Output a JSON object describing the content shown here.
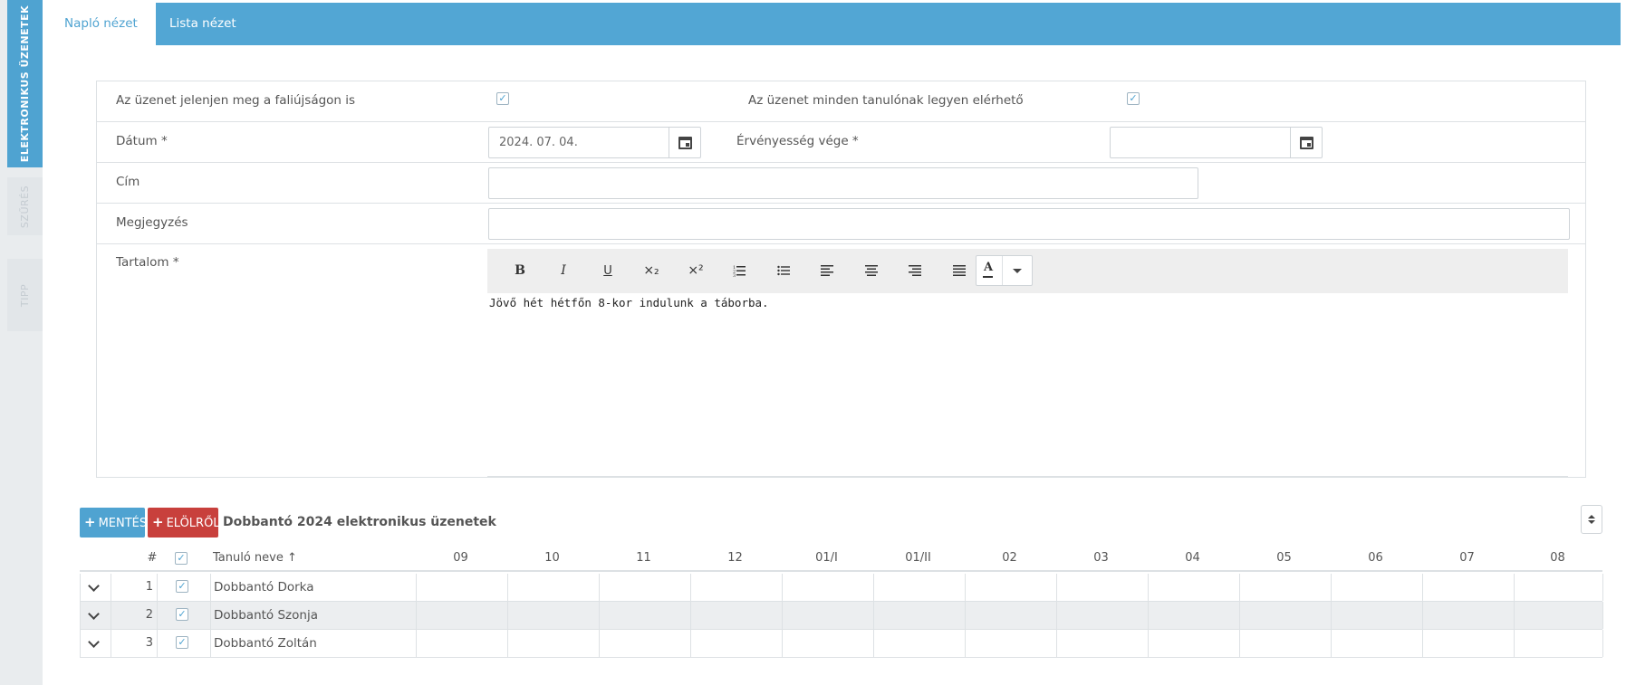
{
  "sidebar": {
    "tabs": [
      {
        "label": "ELEKTRONIKUS ÜZENETEK"
      },
      {
        "label": "SZŰRÉS"
      },
      {
        "label": "TIPP"
      }
    ]
  },
  "top_tabs": [
    {
      "label": "Napló nézet"
    },
    {
      "label": "Lista nézet"
    }
  ],
  "form": {
    "wall_label": "Az üzenet jelenjen meg a faliújságon is",
    "wall_checked": true,
    "all_students_label": "Az üzenet minden tanulónak legyen elérhető",
    "all_students_checked": true,
    "date_label": "Dátum *",
    "date_value": "2024. 07. 04.",
    "expiry_label": "Érvényesség vége *",
    "expiry_value": "",
    "title_label": "Cím",
    "title_value": "",
    "note_label": "Megjegyzés",
    "note_value": "",
    "content_label": "Tartalom *",
    "content_value": "Jövő hét hétfőn 8-kor indulunk a táborba."
  },
  "editor_toolbar": {
    "bold": "B",
    "italic": "I",
    "underline": "U",
    "subscript": "×₂",
    "superscript": "×²",
    "text_color": "A",
    "icons": [
      "bold-icon",
      "italic-icon",
      "underline-icon",
      "subscript-icon",
      "superscript-icon",
      "ordered-list-icon",
      "bullet-list-icon",
      "align-left-icon",
      "align-center-icon",
      "align-right-icon",
      "justify-icon",
      "text-color-icon",
      "dropdown-caret-icon"
    ]
  },
  "actions": {
    "save_label": "MENTÉS",
    "reset_label": "ELÖLRŐL",
    "list_title": "Dobbantó 2024 elektronikus üzenetek"
  },
  "table": {
    "headers": {
      "num": "#",
      "name": "Tanuló neve",
      "sort_arrow": "↑"
    },
    "months": [
      "09",
      "10",
      "11",
      "12",
      "01/I",
      "01/II",
      "02",
      "03",
      "04",
      "05",
      "06",
      "07",
      "08"
    ],
    "rows": [
      {
        "num": "1",
        "name": "Dobbantó Dorka",
        "checked": true
      },
      {
        "num": "2",
        "name": "Dobbantó Szonja",
        "checked": true
      },
      {
        "num": "3",
        "name": "Dobbantó Zoltán",
        "checked": true
      }
    ]
  },
  "colors": {
    "accent": "#52a6d4",
    "danger": "#c8403c",
    "sidebar_bg": "#e9ecee",
    "row_alt": "#eceef0"
  }
}
